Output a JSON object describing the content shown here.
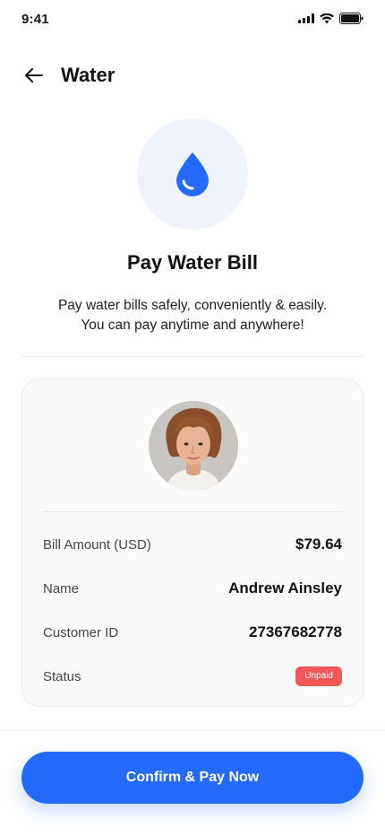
{
  "status_bar": {
    "time": "9:41"
  },
  "header": {
    "title": "Water"
  },
  "hero": {
    "title": "Pay Water Bill",
    "description_line1": "Pay water bills safely, conveniently & easily.",
    "description_line2": "You can pay anytime and anywhere!",
    "icon": "water-drop-icon",
    "accent_color": "#246bfd",
    "icon_bg_color": "#eef3fe"
  },
  "bill": {
    "amount_label": "Bill Amount (USD)",
    "amount_value": "$79.64",
    "name_label": "Name",
    "name_value": "Andrew Ainsley",
    "customer_id_label": "Customer ID",
    "customer_id_value": "27367682778",
    "status_label": "Status",
    "status_value": "Unpaid",
    "status_color": "#f25757"
  },
  "actions": {
    "confirm_label": "Confirm & Pay Now"
  }
}
